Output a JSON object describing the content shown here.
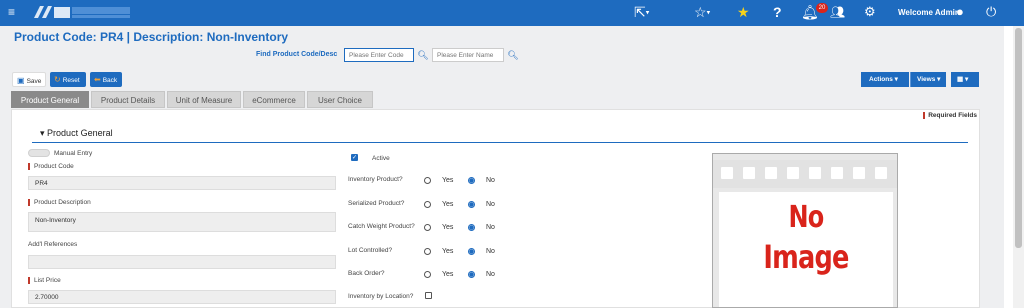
{
  "topbar": {
    "logo_text": "SOLUTIONS",
    "notifications_count": "20",
    "welcome": "Welcome Admin"
  },
  "header": {
    "title": "Product Code:  PR4 | Description: Non-Inventory",
    "find_label": "Find Product Code/Desc",
    "code_placeholder": "Please Enter Code",
    "name_placeholder": "Please Enter Name"
  },
  "toolbar": {
    "save": "Save",
    "reset": "Reset",
    "back": "Back",
    "actions": "Actions",
    "views": "Views"
  },
  "tabs": [
    {
      "label": "Product General"
    },
    {
      "label": "Product Details"
    },
    {
      "label": "Unit of Measure"
    },
    {
      "label": "eCommerce"
    },
    {
      "label": "User Choice"
    }
  ],
  "panel": {
    "required_fields": "Required Fields",
    "section_title": "Product General"
  },
  "form": {
    "manual_entry": "Manual Entry",
    "product_code_label": "Product Code",
    "product_code_value": "PR4",
    "product_description_label": "Product Description",
    "product_description_value": "Non-Inventory",
    "addl_references_label": "Add'l References",
    "addl_references_value": "",
    "list_price_label": "List Price",
    "list_price_value": "2.70000",
    "active_label": "Active",
    "yes": "Yes",
    "no": "No",
    "questions": [
      {
        "label": "Inventory Product?"
      },
      {
        "label": "Serialized Product?"
      },
      {
        "label": "Catch Weight Product?"
      },
      {
        "label": "Lot Controlled?"
      },
      {
        "label": "Back Order?"
      }
    ],
    "inventory_by_location_label": "Inventory by Location?"
  },
  "image_placeholder": {
    "line1": "No",
    "line2": "Image"
  },
  "colors": {
    "brand": "#1e6bbf",
    "required": "#c0392b",
    "tab_active": "#8a8a8a",
    "no_image": "#d9241b",
    "star": "#f7d21a"
  }
}
